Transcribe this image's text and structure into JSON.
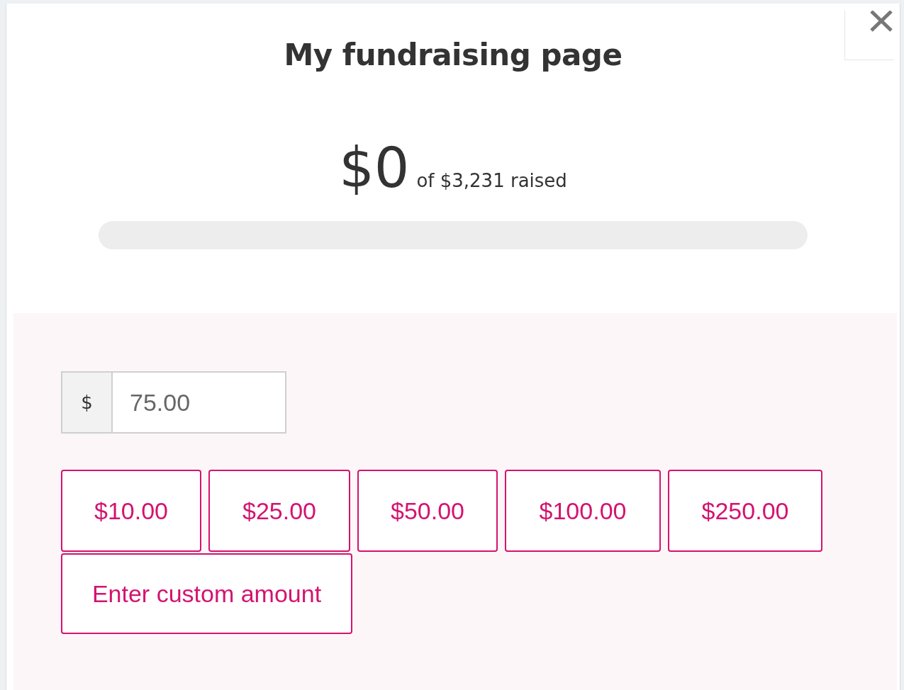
{
  "title": "My fundraising page",
  "progress": {
    "raised": "$0",
    "goal_text": "of $3,231 raised",
    "level": 0
  },
  "amount_field": {
    "prefix": "$",
    "value": "75.00"
  },
  "preset_amounts": [
    {
      "label": "$10.00",
      "selected": false
    },
    {
      "label": "$25.00",
      "selected": false
    },
    {
      "label": "$50.00",
      "selected": false
    },
    {
      "label": "$100.00",
      "selected": false
    },
    {
      "label": "$250.00",
      "selected": false
    }
  ],
  "custom_amount": {
    "label": "Enter custom amount",
    "selected": false
  }
}
